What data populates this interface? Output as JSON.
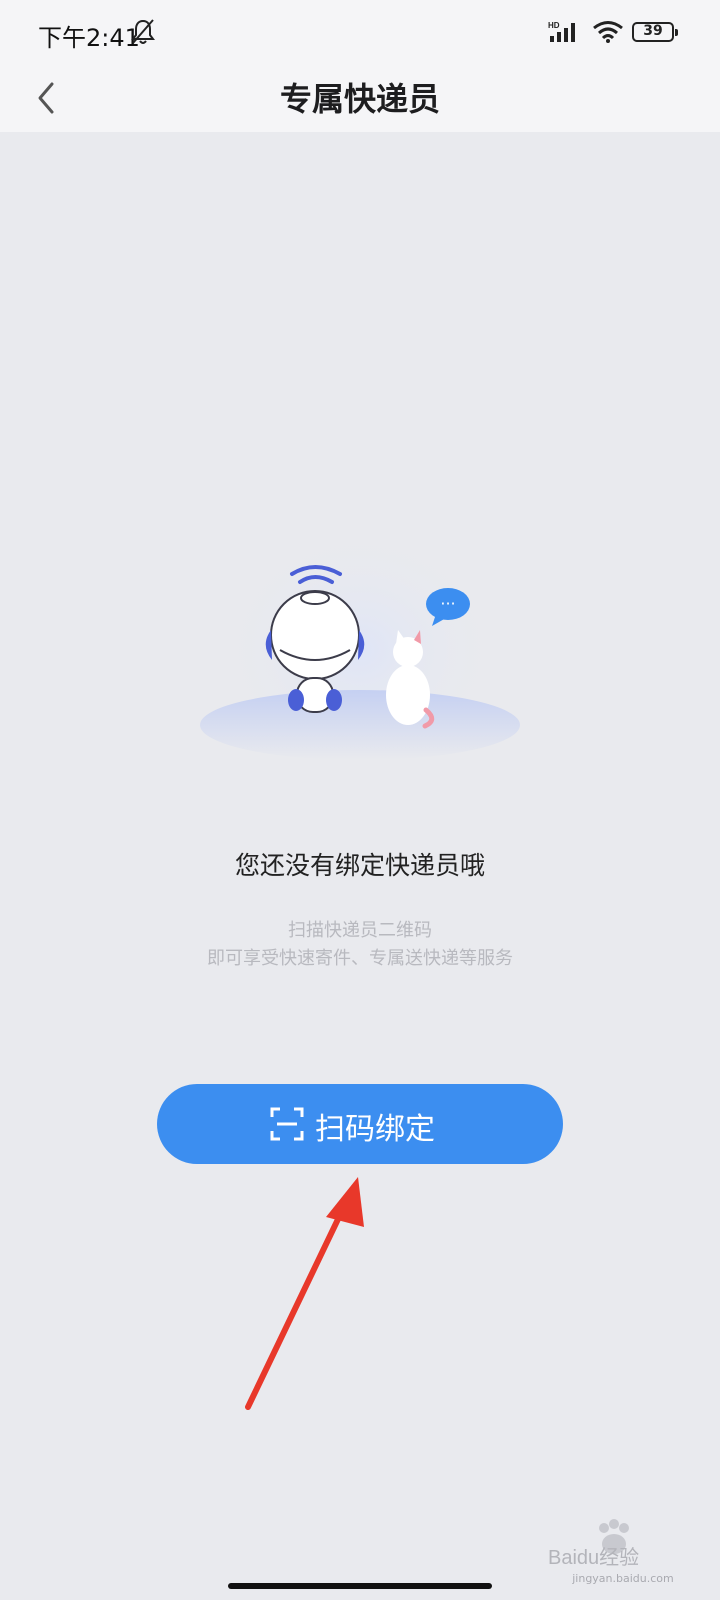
{
  "status_bar": {
    "time": "下午2:41",
    "signal_badge": "HD",
    "battery_level": "39",
    "icons": [
      "bell-off-icon",
      "signal-icon",
      "wifi-icon",
      "battery-icon"
    ]
  },
  "header": {
    "title": "专属快递员",
    "back_icon": "chevron-left-icon"
  },
  "empty_state": {
    "title": "您还没有绑定快递员哦",
    "description_line1": "扫描快递员二维码",
    "description_line2": "即可享受快速寄件、专属送快递等服务",
    "chat_bubble": "···"
  },
  "scan_button": {
    "label": "扫码绑定",
    "icon": "scan-frame-icon"
  },
  "watermark": {
    "brand": "Baidu经验",
    "url": "jingyan.baidu.com"
  },
  "colors": {
    "accent": "#3c8ef0",
    "annotation_arrow": "#e8382a",
    "background": "#e9eaee"
  }
}
